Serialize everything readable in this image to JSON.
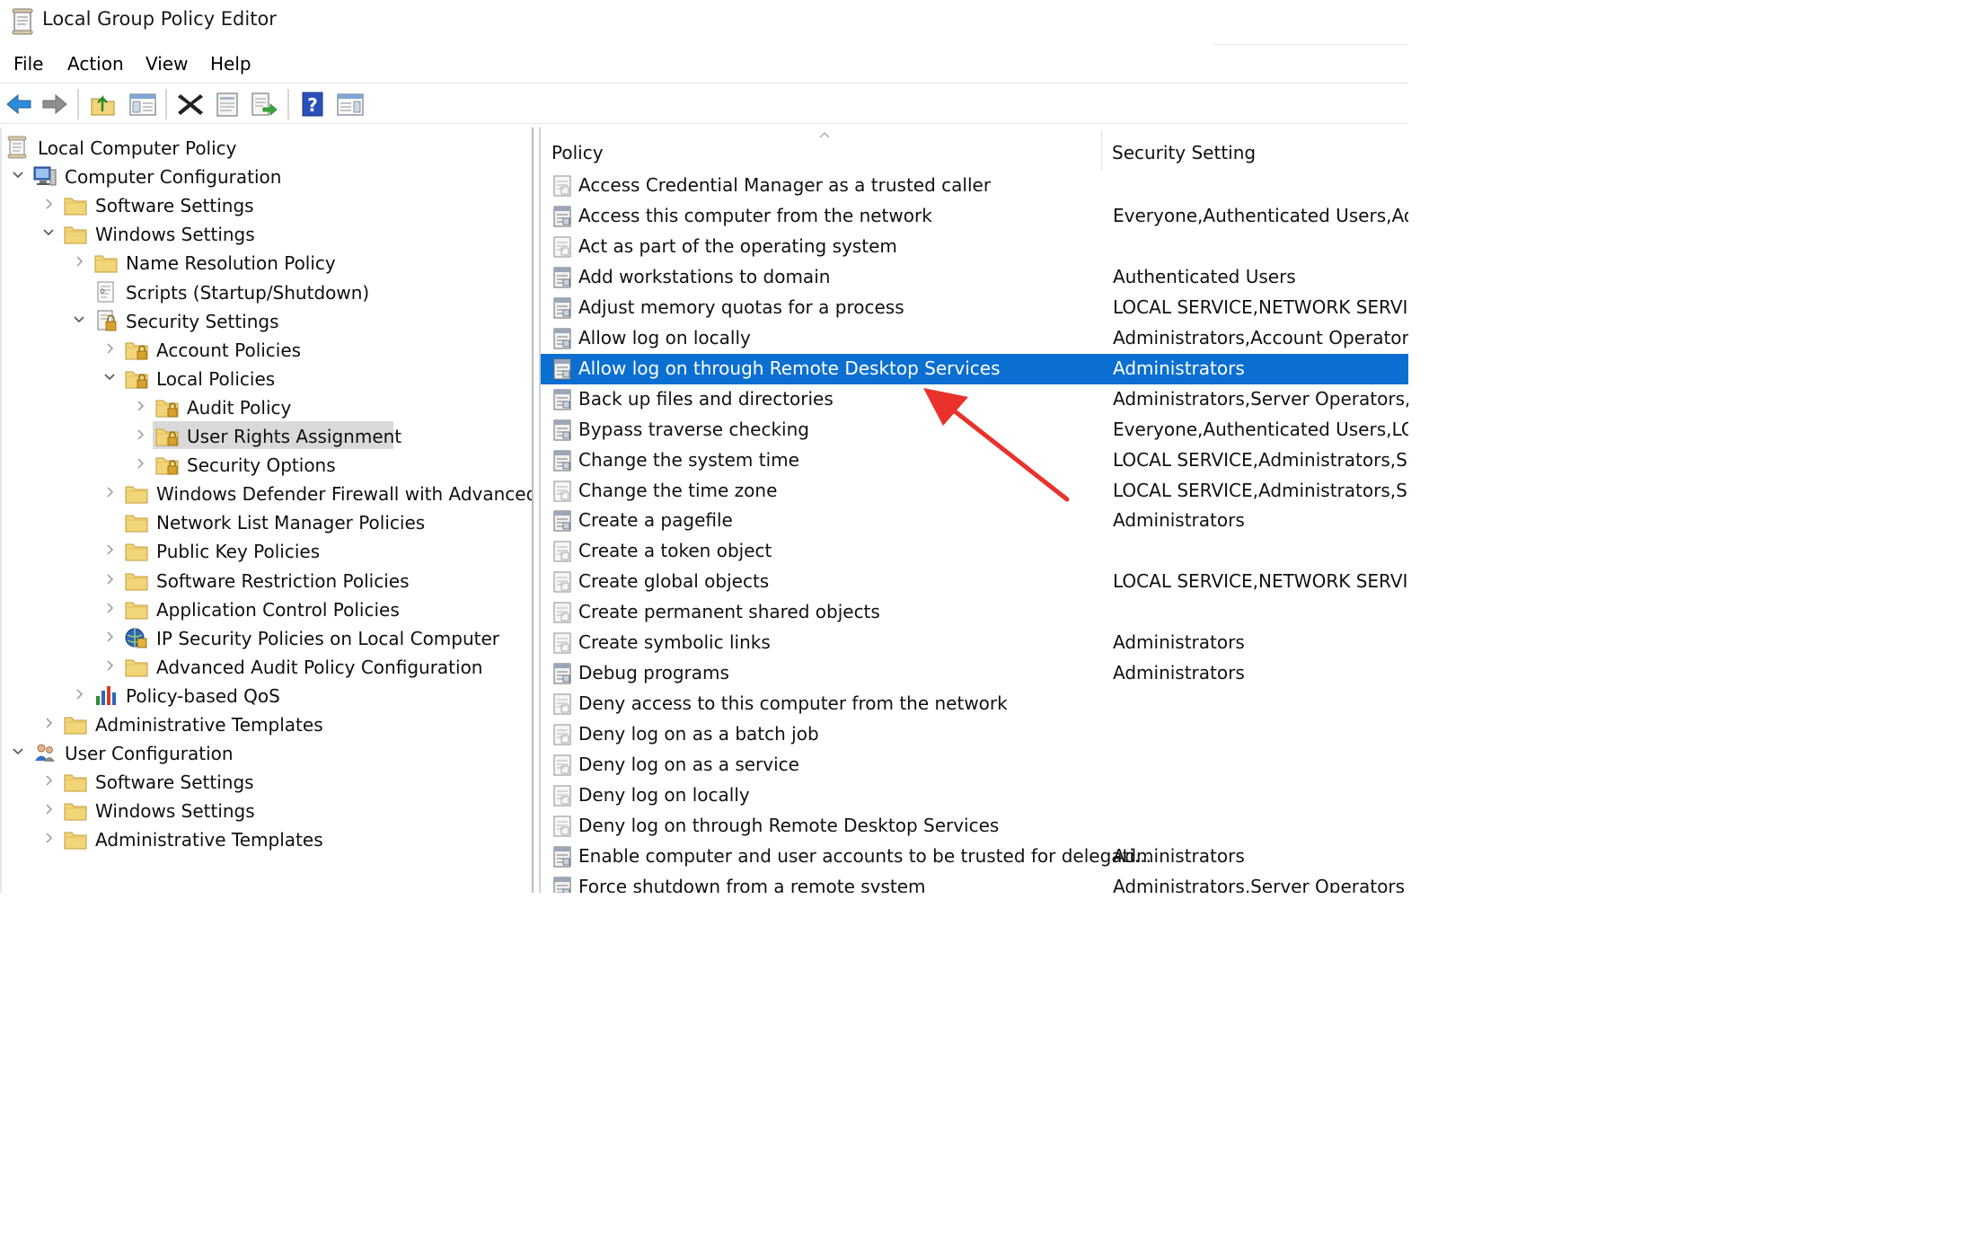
{
  "window": {
    "title": "Local Group Policy Editor"
  },
  "menu": [
    "File",
    "Action",
    "View",
    "Help"
  ],
  "toolbar": [
    {
      "name": "back-arrow-icon"
    },
    {
      "name": "forward-arrow-icon"
    },
    {
      "name": "up-folder-icon"
    },
    {
      "name": "show-hide-tree-icon"
    },
    {
      "name": "delete-icon"
    },
    {
      "name": "properties-icon"
    },
    {
      "name": "export-list-icon"
    },
    {
      "name": "help-icon"
    },
    {
      "name": "show-hide-action-pane-icon"
    }
  ],
  "tree": [
    {
      "label": "Local Computer Policy",
      "icon": "policy-scroll-icon",
      "level": 0,
      "expander": "none"
    },
    {
      "label": "Computer Configuration",
      "icon": "computer-icon",
      "level": 1,
      "expander": "expanded"
    },
    {
      "label": "Software Settings",
      "icon": "folder-icon",
      "level": 2,
      "expander": "collapsed"
    },
    {
      "label": "Windows Settings",
      "icon": "folder-icon",
      "level": 2,
      "expander": "expanded"
    },
    {
      "label": "Name Resolution Policy",
      "icon": "folder-icon",
      "level": 3,
      "expander": "collapsed"
    },
    {
      "label": "Scripts (Startup/Shutdown)",
      "icon": "scripts-icon",
      "level": 3,
      "expander": "none"
    },
    {
      "label": "Security Settings",
      "icon": "security-settings-icon",
      "level": 3,
      "expander": "expanded"
    },
    {
      "label": "Account Policies",
      "icon": "locked-folder-icon",
      "level": 4,
      "expander": "collapsed"
    },
    {
      "label": "Local Policies",
      "icon": "locked-folder-icon",
      "level": 4,
      "expander": "expanded"
    },
    {
      "label": "Audit Policy",
      "icon": "locked-folder-icon",
      "level": 5,
      "expander": "collapsed"
    },
    {
      "label": "User Rights Assignment",
      "icon": "locked-folder-icon",
      "level": 5,
      "expander": "collapsed",
      "selected": true
    },
    {
      "label": "Security Options",
      "icon": "locked-folder-icon",
      "level": 5,
      "expander": "collapsed"
    },
    {
      "label": "Windows Defender Firewall with Advanced Se",
      "icon": "folder-icon",
      "level": 4,
      "expander": "collapsed"
    },
    {
      "label": "Network List Manager Policies",
      "icon": "folder-icon",
      "level": 4,
      "expander": "none"
    },
    {
      "label": "Public Key Policies",
      "icon": "folder-icon",
      "level": 4,
      "expander": "collapsed"
    },
    {
      "label": "Software Restriction Policies",
      "icon": "folder-icon",
      "level": 4,
      "expander": "collapsed"
    },
    {
      "label": "Application Control Policies",
      "icon": "folder-icon",
      "level": 4,
      "expander": "collapsed"
    },
    {
      "label": "IP Security Policies on Local Computer",
      "icon": "ip-security-icon",
      "level": 4,
      "expander": "collapsed"
    },
    {
      "label": "Advanced Audit Policy Configuration",
      "icon": "folder-icon",
      "level": 4,
      "expander": "collapsed"
    },
    {
      "label": "Policy-based QoS",
      "icon": "qos-chart-icon",
      "level": 3,
      "expander": "collapsed"
    },
    {
      "label": "Administrative Templates",
      "icon": "folder-icon",
      "level": 2,
      "expander": "collapsed"
    },
    {
      "label": "User Configuration",
      "icon": "users-icon",
      "level": 1,
      "expander": "expanded"
    },
    {
      "label": "Software Settings",
      "icon": "folder-icon",
      "level": 2,
      "expander": "collapsed"
    },
    {
      "label": "Windows Settings",
      "icon": "folder-icon",
      "level": 2,
      "expander": "collapsed"
    },
    {
      "label": "Administrative Templates",
      "icon": "folder-icon",
      "level": 2,
      "expander": "collapsed"
    }
  ],
  "list": {
    "columns": [
      "Policy",
      "Security Setting"
    ],
    "rows": [
      {
        "policy": "Access Credential Manager as a trusted caller",
        "setting": "",
        "icon": "policy-doc-icon"
      },
      {
        "policy": "Access this computer from the network",
        "setting": "Everyone,Authenticated Users,Admir",
        "icon": "policy-doc-set-icon"
      },
      {
        "policy": "Act as part of the operating system",
        "setting": "",
        "icon": "policy-doc-icon"
      },
      {
        "policy": "Add workstations to domain",
        "setting": "Authenticated Users",
        "icon": "policy-doc-set-icon"
      },
      {
        "policy": "Adjust memory quotas for a process",
        "setting": "LOCAL SERVICE,NETWORK SERVICE,A",
        "icon": "policy-doc-set-icon"
      },
      {
        "policy": "Allow log on locally",
        "setting": "Administrators,Account Operators,Se",
        "icon": "policy-doc-set-icon"
      },
      {
        "policy": "Allow log on through Remote Desktop Services",
        "setting": "Administrators",
        "icon": "policy-doc-set-icon",
        "selected": true
      },
      {
        "policy": "Back up files and directories",
        "setting": "Administrators,Server Operators,Bac",
        "icon": "policy-doc-set-icon"
      },
      {
        "policy": "Bypass traverse checking",
        "setting": "Everyone,Authenticated Users,LOCA",
        "icon": "policy-doc-set-icon"
      },
      {
        "policy": "Change the system time",
        "setting": "LOCAL SERVICE,Administrators,Serve",
        "icon": "policy-doc-set-icon"
      },
      {
        "policy": "Change the time zone",
        "setting": "LOCAL SERVICE,Administrators,Serve",
        "icon": "policy-doc-icon"
      },
      {
        "policy": "Create a pagefile",
        "setting": "Administrators",
        "icon": "policy-doc-set-icon"
      },
      {
        "policy": "Create a token object",
        "setting": "",
        "icon": "policy-doc-icon"
      },
      {
        "policy": "Create global objects",
        "setting": "LOCAL SERVICE,NETWORK SERVICE,A",
        "icon": "policy-doc-icon"
      },
      {
        "policy": "Create permanent shared objects",
        "setting": "",
        "icon": "policy-doc-icon"
      },
      {
        "policy": "Create symbolic links",
        "setting": "Administrators",
        "icon": "policy-doc-icon"
      },
      {
        "policy": "Debug programs",
        "setting": "Administrators",
        "icon": "policy-doc-set-icon"
      },
      {
        "policy": "Deny access to this computer from the network",
        "setting": "",
        "icon": "policy-doc-icon"
      },
      {
        "policy": "Deny log on as a batch job",
        "setting": "",
        "icon": "policy-doc-icon"
      },
      {
        "policy": "Deny log on as a service",
        "setting": "",
        "icon": "policy-doc-icon"
      },
      {
        "policy": "Deny log on locally",
        "setting": "",
        "icon": "policy-doc-icon"
      },
      {
        "policy": "Deny log on through Remote Desktop Services",
        "setting": "",
        "icon": "policy-doc-icon"
      },
      {
        "policy": "Enable computer and user accounts to be trusted for delegati...",
        "setting": "Administrators",
        "icon": "policy-doc-set-icon"
      },
      {
        "policy": "Force shutdown from a remote system",
        "setting": "Administrators,Server Operators",
        "icon": "policy-doc-set-icon"
      }
    ]
  },
  "colors": {
    "selection": "#0b6fd1",
    "tree_selection": "#d9d9d9",
    "annotation_arrow": "#e8322b",
    "folder": "#f3d579"
  }
}
